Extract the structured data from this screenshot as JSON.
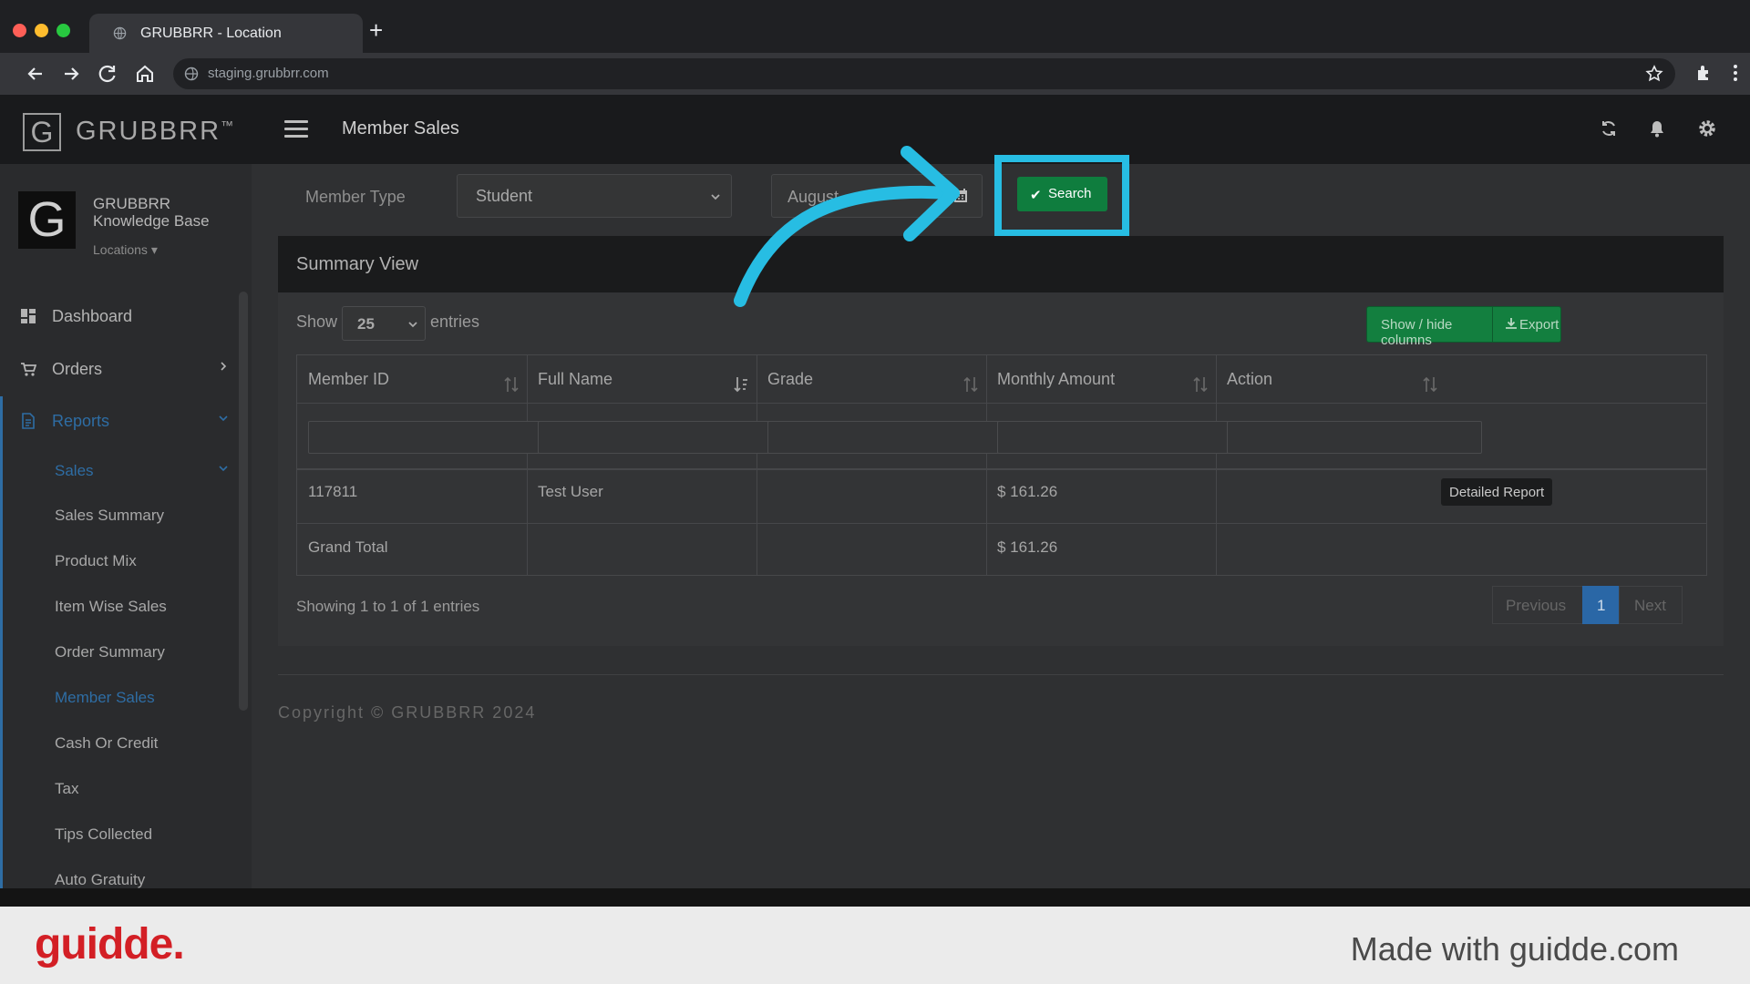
{
  "browser": {
    "tab_title": "GRUBBRR - Location",
    "new_tab": "+",
    "url": "staging.grubbrr.com"
  },
  "app": {
    "logo_letter": "G",
    "logo_text": "GRUBBRR",
    "logo_tm": "™",
    "page_title": "Member Sales"
  },
  "profile": {
    "letter": "G",
    "name_line1": "GRUBBRR",
    "name_line2": "Knowledge Base",
    "locations": "Locations ▾"
  },
  "sidebar": {
    "items": [
      {
        "label": "Dashboard",
        "icon": "dashboard-icon"
      },
      {
        "label": "Orders",
        "icon": "cart-icon"
      },
      {
        "label": "Reports",
        "icon": "report-icon"
      }
    ],
    "sales_label": "Sales",
    "sub_items": [
      "Sales Summary",
      "Product Mix",
      "Item Wise Sales",
      "Order Summary",
      "Member Sales",
      "Cash Or Credit",
      "Tax",
      "Tips Collected",
      "Auto Gratuity"
    ]
  },
  "filters": {
    "member_type_label": "Member Type",
    "member_type_value": "Student",
    "date_value": "August",
    "search_label": "Search"
  },
  "panel": {
    "title": "Summary View",
    "show_label": "Show",
    "show_value": "25",
    "entries_label": "entries",
    "show_hide_label": "Show / hide columns",
    "export_label": "Export"
  },
  "table": {
    "headers": [
      "Member ID",
      "Full Name",
      "Grade",
      "Monthly Amount",
      "Action"
    ],
    "rows": [
      {
        "member_id": "117811",
        "full_name": "Test User",
        "grade": "",
        "monthly_amount": "$ 161.26",
        "action": "Detailed Report"
      }
    ],
    "total": {
      "label": "Grand Total",
      "monthly_amount": "$ 161.26"
    }
  },
  "pagination": {
    "info": "Showing 1 to 1 of 1 entries",
    "previous": "Previous",
    "current": "1",
    "next": "Next"
  },
  "footer": {
    "copyright": "Copyright © GRUBBRR 2024"
  },
  "guidde": {
    "logo": "guidde.",
    "made_with": "Made with guidde.com"
  },
  "colors": {
    "accent_blue": "#2a67a6",
    "highlight_cyan": "#27bde3",
    "green": "#0f7d3e",
    "brand_red": "#d31f25"
  }
}
